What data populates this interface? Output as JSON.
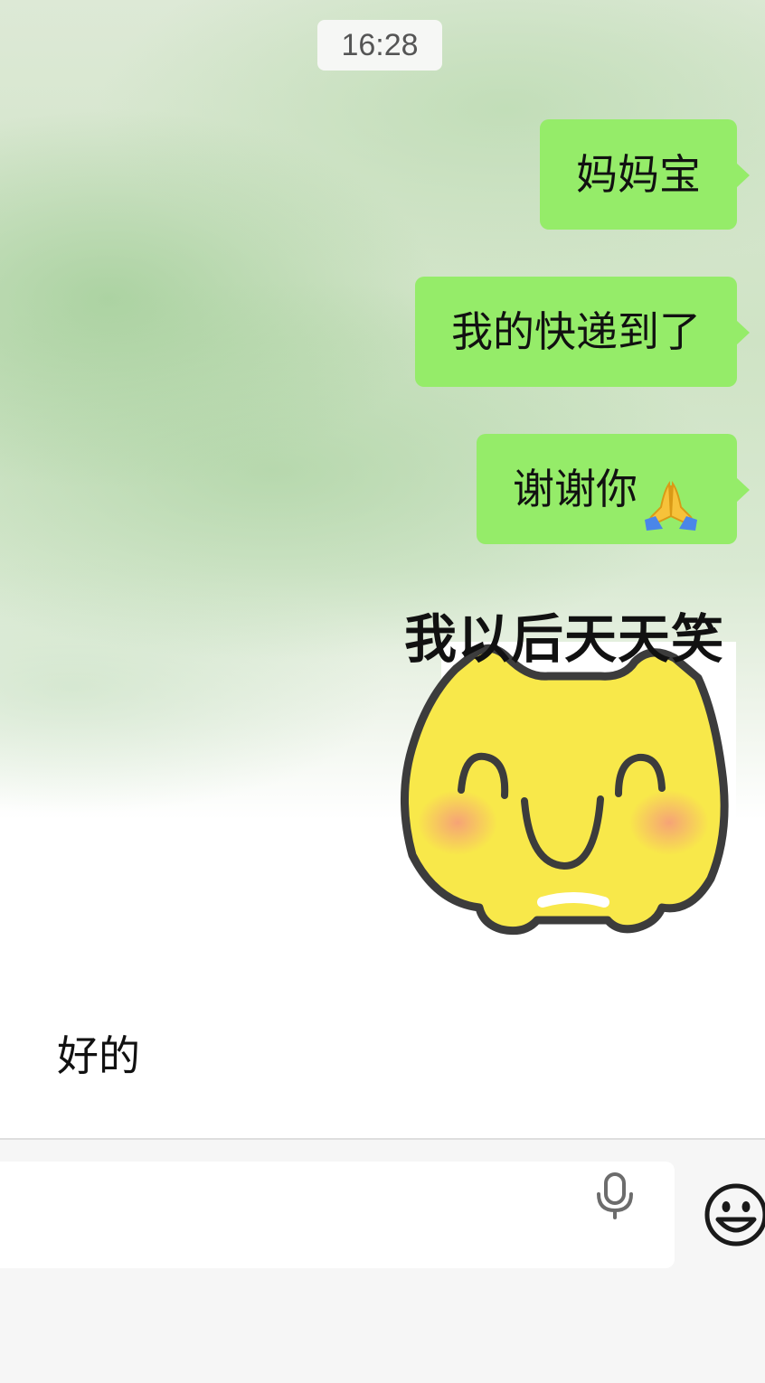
{
  "chat": {
    "timestamp": "16:28",
    "messages": [
      {
        "text": "妈妈宝"
      },
      {
        "text": "我的快递到了"
      },
      {
        "text": "谢谢你",
        "emoji": "folded-hands-icon"
      }
    ],
    "sticker": {
      "caption": "我以后天天笑",
      "icon": "smiling-cat-sticker"
    }
  },
  "composer": {
    "draft_text": "好的",
    "voice_icon": "microphone-icon",
    "emoji_icon": "smiley-face-icon"
  },
  "colors": {
    "bubble_sent": "#95ec69",
    "bar_background": "#f6f6f6"
  }
}
